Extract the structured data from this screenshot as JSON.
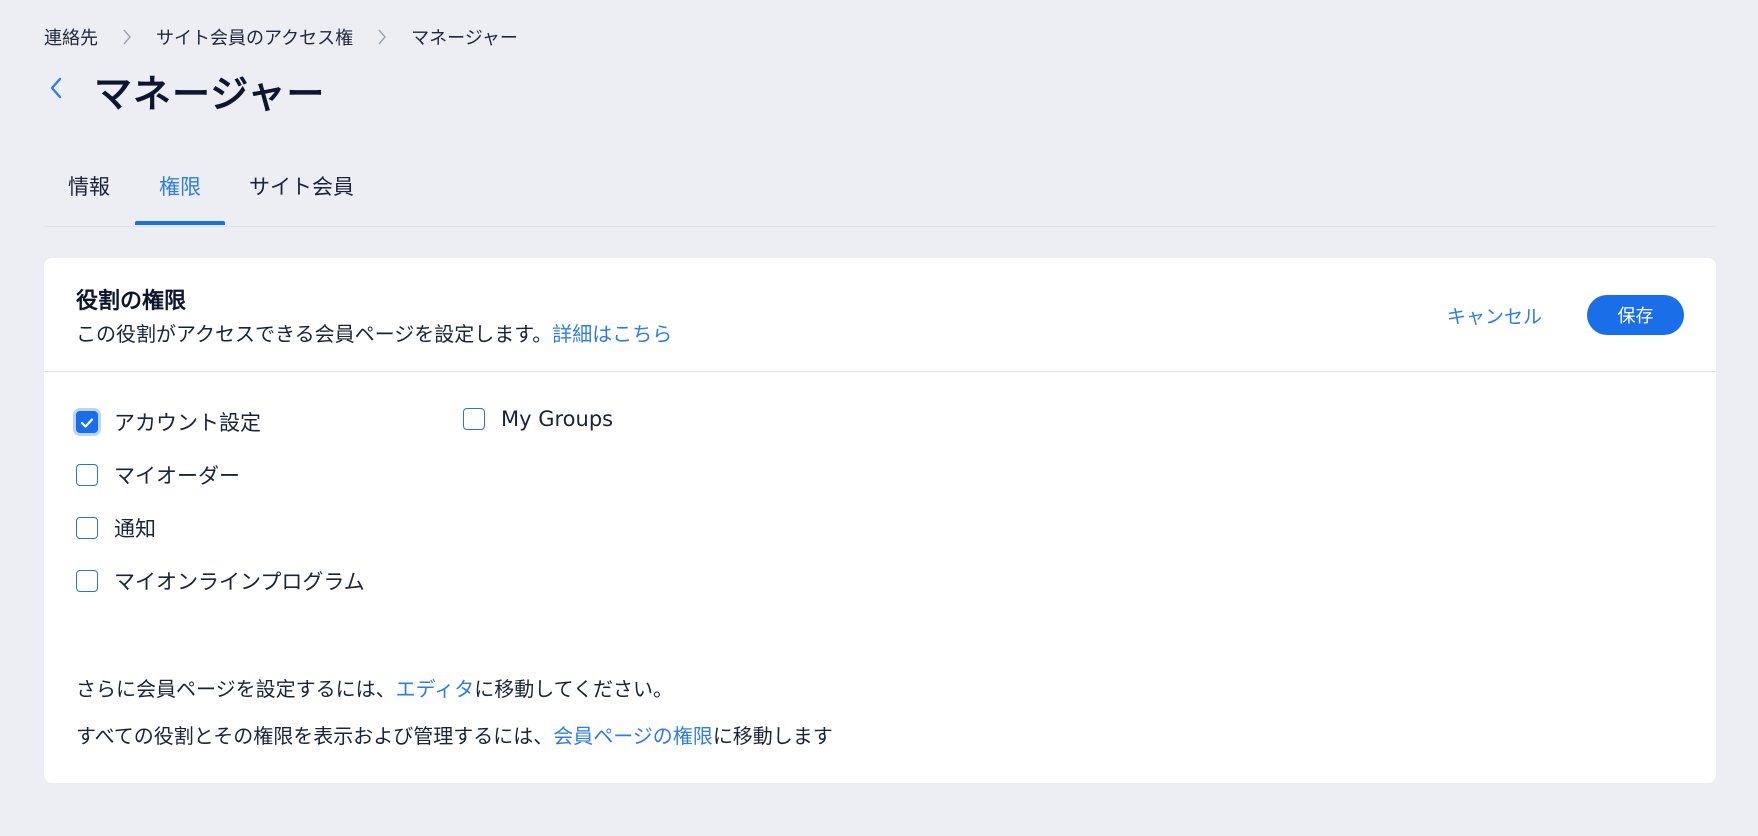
{
  "breadcrumb": {
    "items": [
      "連絡先",
      "サイト会員のアクセス権",
      "マネージャー"
    ]
  },
  "page_title": "マネージャー",
  "tabs": [
    {
      "label": "情報",
      "active": false
    },
    {
      "label": "権限",
      "active": true
    },
    {
      "label": "サイト会員",
      "active": false
    }
  ],
  "card": {
    "title": "役割の権限",
    "description": "この役割がアクセスできる会員ページを設定します。",
    "description_link": "詳細はこちら",
    "cancel_label": "キャンセル",
    "save_label": "保存"
  },
  "options": [
    {
      "label": "アカウント設定",
      "checked": true
    },
    {
      "label": "マイオーダー",
      "checked": false
    },
    {
      "label": "通知",
      "checked": false
    },
    {
      "label": "マイオンラインプログラム",
      "checked": false
    },
    {
      "label": "My Groups",
      "checked": false
    }
  ],
  "footer": {
    "line1_prefix": "さらに会員ページを設定するには、",
    "line1_link": "エディタ",
    "line1_suffix": "に移動してください。",
    "line2_prefix": "すべての役割とその権限を表示および管理するには、",
    "line2_link": "会員ページの権限",
    "line2_suffix": "に移動します"
  },
  "colors": {
    "accent": "#1a6ee8",
    "link": "#2f7de1",
    "background": "#eceef3",
    "card": "#ffffff"
  },
  "icons": {
    "back": "chevron-left-icon",
    "separator": "chevron-right-icon",
    "check": "checkmark-icon"
  }
}
